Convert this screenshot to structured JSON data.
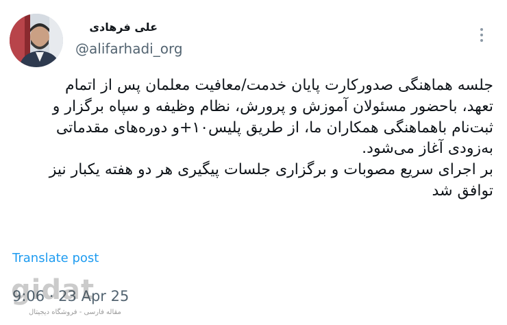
{
  "author": {
    "display_name": "علی فرهادی",
    "handle": "@alifarhadi_org"
  },
  "menu": {
    "icon": "more-vertical-icon"
  },
  "tweet": {
    "lines": [
      "جلسه هماهنگی صدورکارت پایان خدمت/معافیت معلمان پس از اتمام",
      "تعهد، باحضور مسئولان آموزش و پرورش، نظام وظیفه و سپاه برگزار و",
      "ثبت‌نام باهماهنگی همکاران ما، از طریق پلیس۱۰+و دوره‌های مقدماتی",
      "به‌زودی آغاز می‌شود.",
      "بر اجرای سریع مصوبات و برگزاری جلسات پیگیری هر دو هفته یکبار نیز",
      "توافق شد"
    ]
  },
  "translate_label": "Translate post",
  "timestamp": "9:06 · 23 Apr 25",
  "watermark": {
    "logo": "gidat",
    "tagline": "مقاله فارسی - فروشگاه دیجیتال"
  }
}
